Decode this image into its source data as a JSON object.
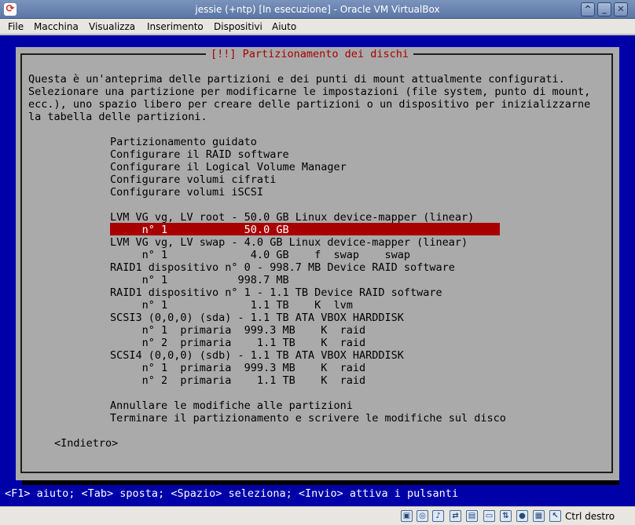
{
  "window": {
    "title": "jessie (+ntp) [In esecuzione] - Oracle VM VirtualBox",
    "app_icon_glyph": "⟳",
    "buttons": {
      "shade": "^",
      "minimize": "_",
      "maximize": "□",
      "close": "✕"
    }
  },
  "menubar": {
    "items": [
      "File",
      "Macchina",
      "Visualizza",
      "Inserimento",
      "Dispositivi",
      "Aiuto"
    ]
  },
  "installer": {
    "dialog_title": "[!!] Partizionamento dei dischi",
    "description": [
      "Questa è un'anteprima delle partizioni e dei punti di mount attualmente configurati.",
      "Selezionare una partizione per modificarne le impostazioni (file system, punto di mount,",
      "ecc.), uno spazio libero per creare delle partizioni o un dispositivo per inizializzarne",
      "la tabella delle partizioni."
    ],
    "actions": [
      "Partizionamento guidato",
      "Configurare il RAID software",
      "Configurare il Logical Volume Manager",
      "Configurare volumi cifrati",
      "Configurare volumi iSCSI"
    ],
    "partitions": [
      "LVM VG vg, LV root - 50.0 GB Linux device-mapper (linear)",
      "     n° 1            50.0 GB",
      "LVM VG vg, LV swap - 4.0 GB Linux device-mapper (linear)",
      "     n° 1             4.0 GB    f  swap    swap",
      "RAID1 dispositivo n° 0 - 998.7 MB Device RAID software",
      "     n° 1           998.7 MB",
      "RAID1 dispositivo n° 1 - 1.1 TB Device RAID software",
      "     n° 1             1.1 TB    K  lvm",
      "SCSI3 (0,0,0) (sda) - 1.1 TB ATA VBOX HARDDISK",
      "     n° 1  primaria  999.3 MB    K  raid",
      "     n° 2  primaria    1.1 TB    K  raid",
      "SCSI4 (0,0,0) (sdb) - 1.1 TB ATA VBOX HARDDISK",
      "     n° 1  primaria  999.3 MB    K  raid",
      "     n° 2  primaria    1.1 TB    K  raid"
    ],
    "selected_partition_index": 1,
    "finish_options": [
      "Annullare le modifiche alle partizioni",
      "Terminare il partizionamento e scrivere le modifiche sul disco"
    ],
    "back_button": "<Indietro>",
    "help": "<F1> aiuto; <Tab> sposta; <Spazio> seleziona; <Invio> attiva i pulsanti"
  },
  "statusbar": {
    "icons": [
      "hdd-icon",
      "optical-disk-icon",
      "audio-icon",
      "usb-icon",
      "shared-folder-icon",
      "display-icon",
      "network-icon",
      "video-capture-icon",
      "virtualization-icon",
      "mouse-integration-icon",
      "host-key-icon"
    ],
    "icon_glyphs": [
      "▣",
      "◎",
      "♪",
      "⇄",
      "▤",
      "▭",
      "⇅",
      "●",
      "▦",
      "↖",
      "↘"
    ],
    "host_key": "Ctrl destro"
  },
  "colors": {
    "vm_background": "#0000a8",
    "dialog_background": "#aaaaaa",
    "selection": "#a80000",
    "title_text": "#a80000"
  }
}
